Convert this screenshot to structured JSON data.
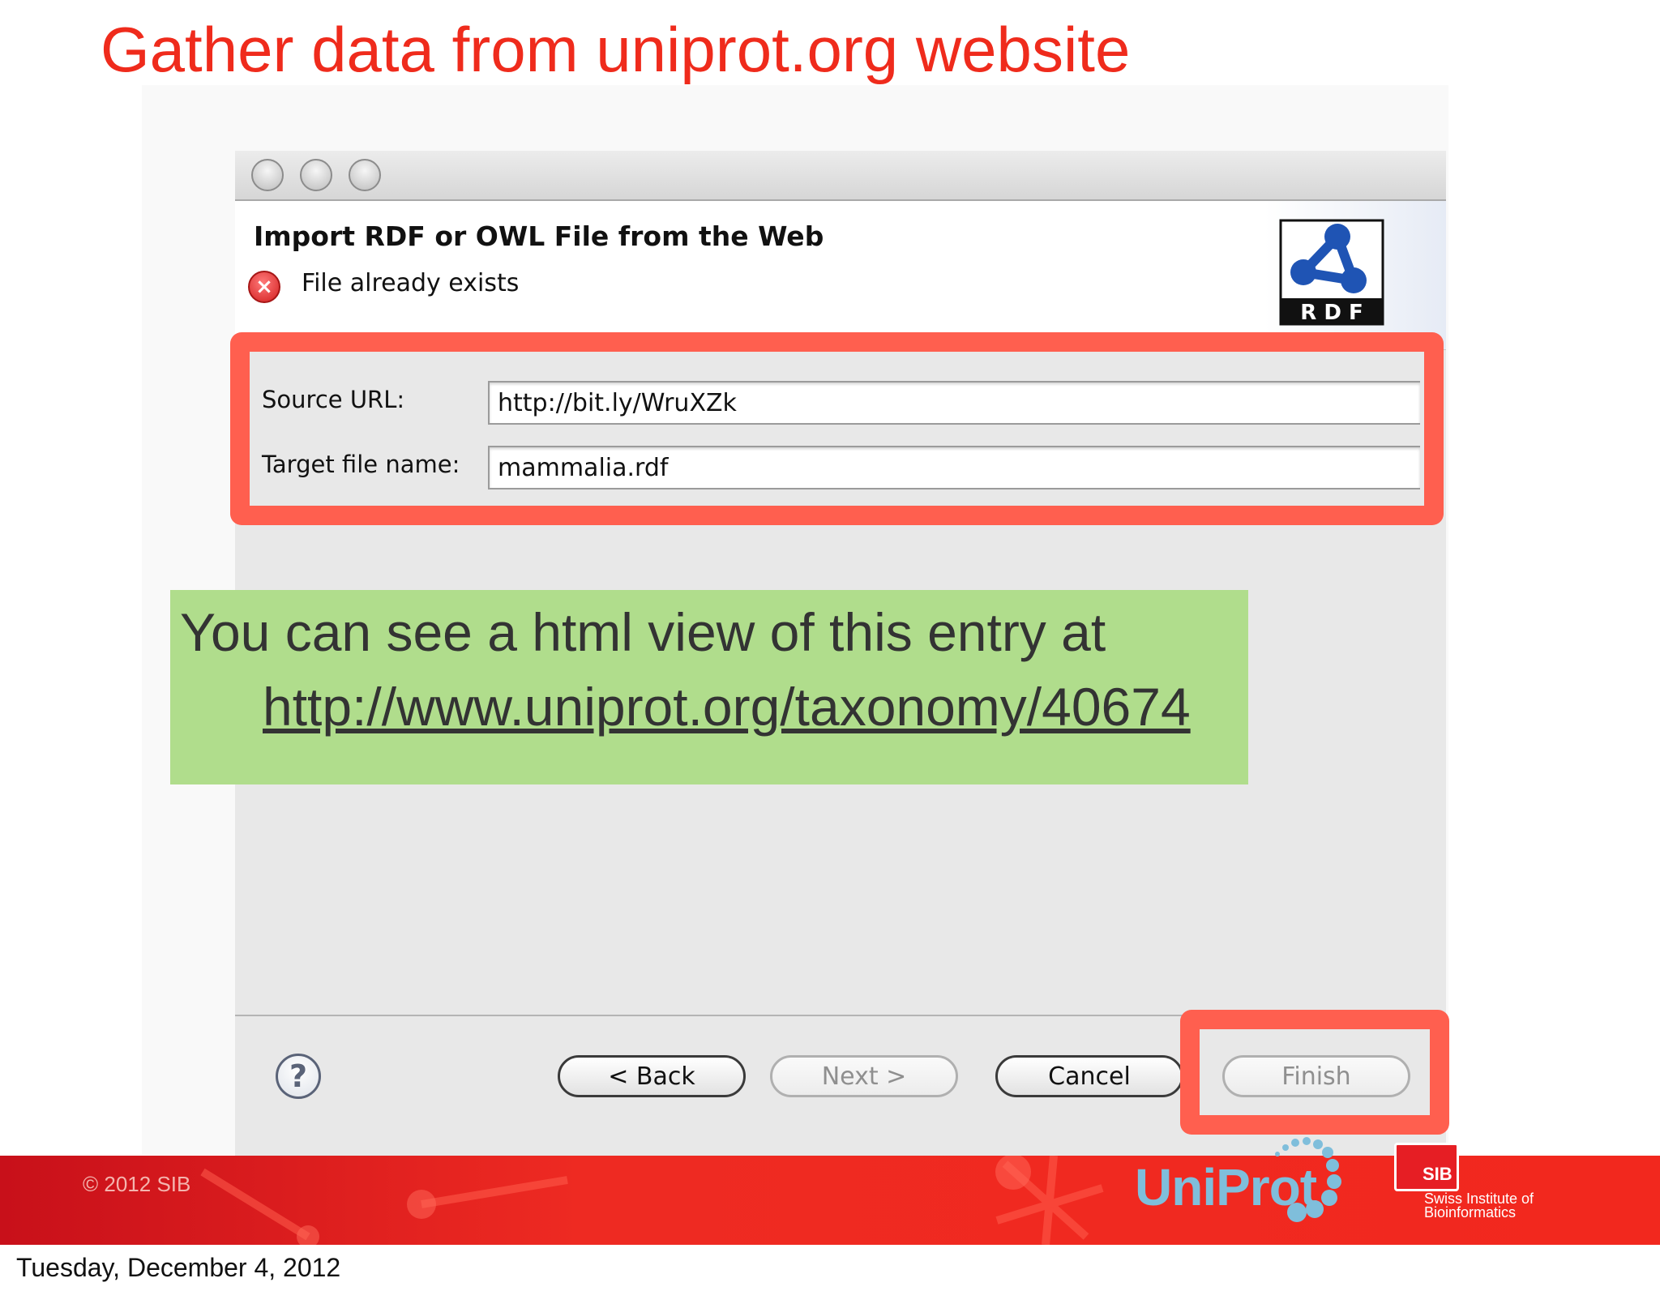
{
  "slide": {
    "title": "Gather data from uniprot.org website",
    "date": "Tuesday, December 4, 2012",
    "copyright": "© 2012 SIB"
  },
  "dialog": {
    "title": "Import RDF or OWL File from the Web",
    "error_message": "File already exists",
    "logo_text": "R D F",
    "fields": {
      "source_label": "Source URL:",
      "source_value": "http://bit.ly/WruXZk",
      "target_label": "Target file name:",
      "target_value": "mammalia.rdf"
    },
    "buttons": {
      "help": "?",
      "back": "< Back",
      "next": "Next >",
      "cancel": "Cancel",
      "finish": "Finish"
    }
  },
  "callout": {
    "text": "You can see a html view of this entry at",
    "link": "http://www.uniprot.org/taxonomy/40674"
  },
  "logos": {
    "uniprot": "UniProt",
    "sib_badge": "SIB",
    "sib_line1": "Swiss Institute of",
    "sib_line2": "Bioinformatics"
  },
  "colors": {
    "title_red": "#ef2b1c",
    "highlight": "#ff5f4f",
    "callout_green": "#b0dd8c",
    "footer_red": "#ee2a22"
  }
}
